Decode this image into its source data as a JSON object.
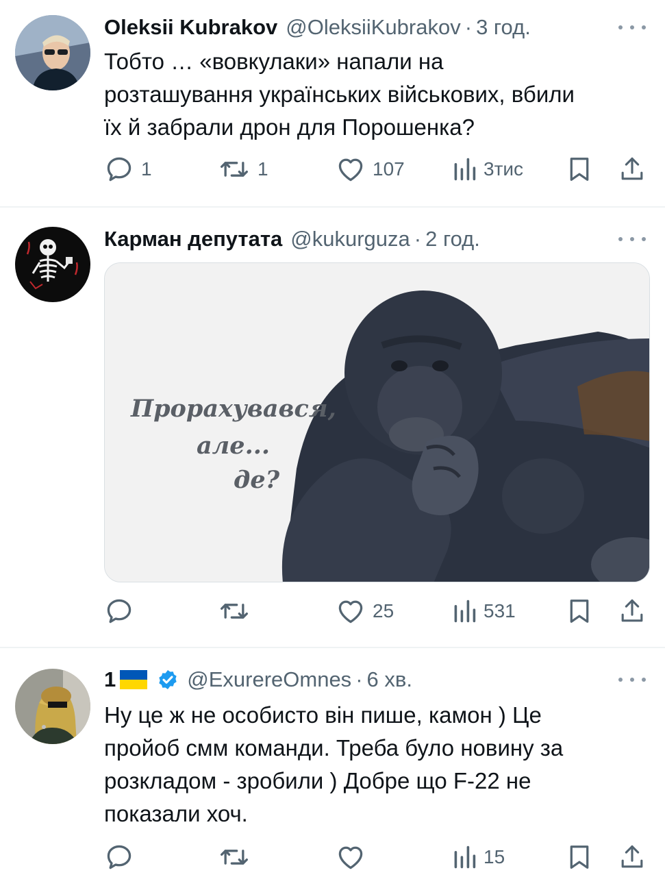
{
  "tweets": [
    {
      "name": "Oleksii Kubrakov",
      "handle": "@OleksiiKubrakov",
      "dot": "·",
      "time": "3 год.",
      "text_lines": [
        "Тобто … «вовкулаки» напали на",
        "розташування українських військових, вбили",
        "їх й забрали дрон для Порошенка?"
      ],
      "replies": "1",
      "reposts": "1",
      "likes": "107",
      "views": "3тис",
      "avatar_icon": "avatar-photo"
    },
    {
      "name": "Карман депутата",
      "handle": "@kukurguza",
      "dot": "·",
      "time": "2 год.",
      "media": {
        "caption_lines": [
          "Прорахувався,",
          "але...",
          "де?"
        ],
        "description_icon": "bonobo-meme-image"
      },
      "replies": "",
      "reposts": "",
      "likes": "25",
      "views": "531",
      "avatar_icon": "skeleton-avatar"
    },
    {
      "name": "1",
      "flag": "ukraine-flag-icon",
      "verified": "verified-badge-icon",
      "handle": "@ExurereOmnes",
      "dot": "·",
      "time": "6 хв.",
      "text_lines": [
        "Ну це ж не особисто він пише, камон ) Це",
        "пройоб смм команди. Треба було новину за",
        "розкладом - зробили ) Добре що F-22 не",
        "показали хоч."
      ],
      "replies": "",
      "reposts": "",
      "likes": "",
      "views": "15",
      "avatar_icon": "masked-person-avatar"
    }
  ],
  "colors": {
    "text": "#0f1419",
    "secondary": "#536471",
    "divider": "#eff3f4",
    "verified": "#1d9bf0",
    "flag_blue": "#0057b7",
    "flag_yellow": "#ffd700"
  }
}
